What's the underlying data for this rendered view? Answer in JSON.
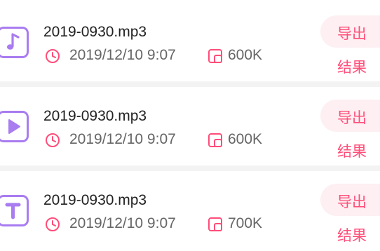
{
  "accent_color": "#ff4d79",
  "icon_color": "#a97cf0",
  "items": [
    {
      "icon": "music-note-icon",
      "file_name": "2019-0930.mp3",
      "date": "2019/12/10 9:07",
      "size": "600K",
      "export_label": "导出",
      "result_label": "结果"
    },
    {
      "icon": "play-icon",
      "file_name": "2019-0930.mp3",
      "date": "2019/12/10 9:07",
      "size": "600K",
      "export_label": "导出",
      "result_label": "结果"
    },
    {
      "icon": "text-t-icon",
      "file_name": "2019-0930.mp3",
      "date": "2019/12/10 9:07",
      "size": "700K",
      "export_label": "导出",
      "result_label": "结果"
    }
  ]
}
